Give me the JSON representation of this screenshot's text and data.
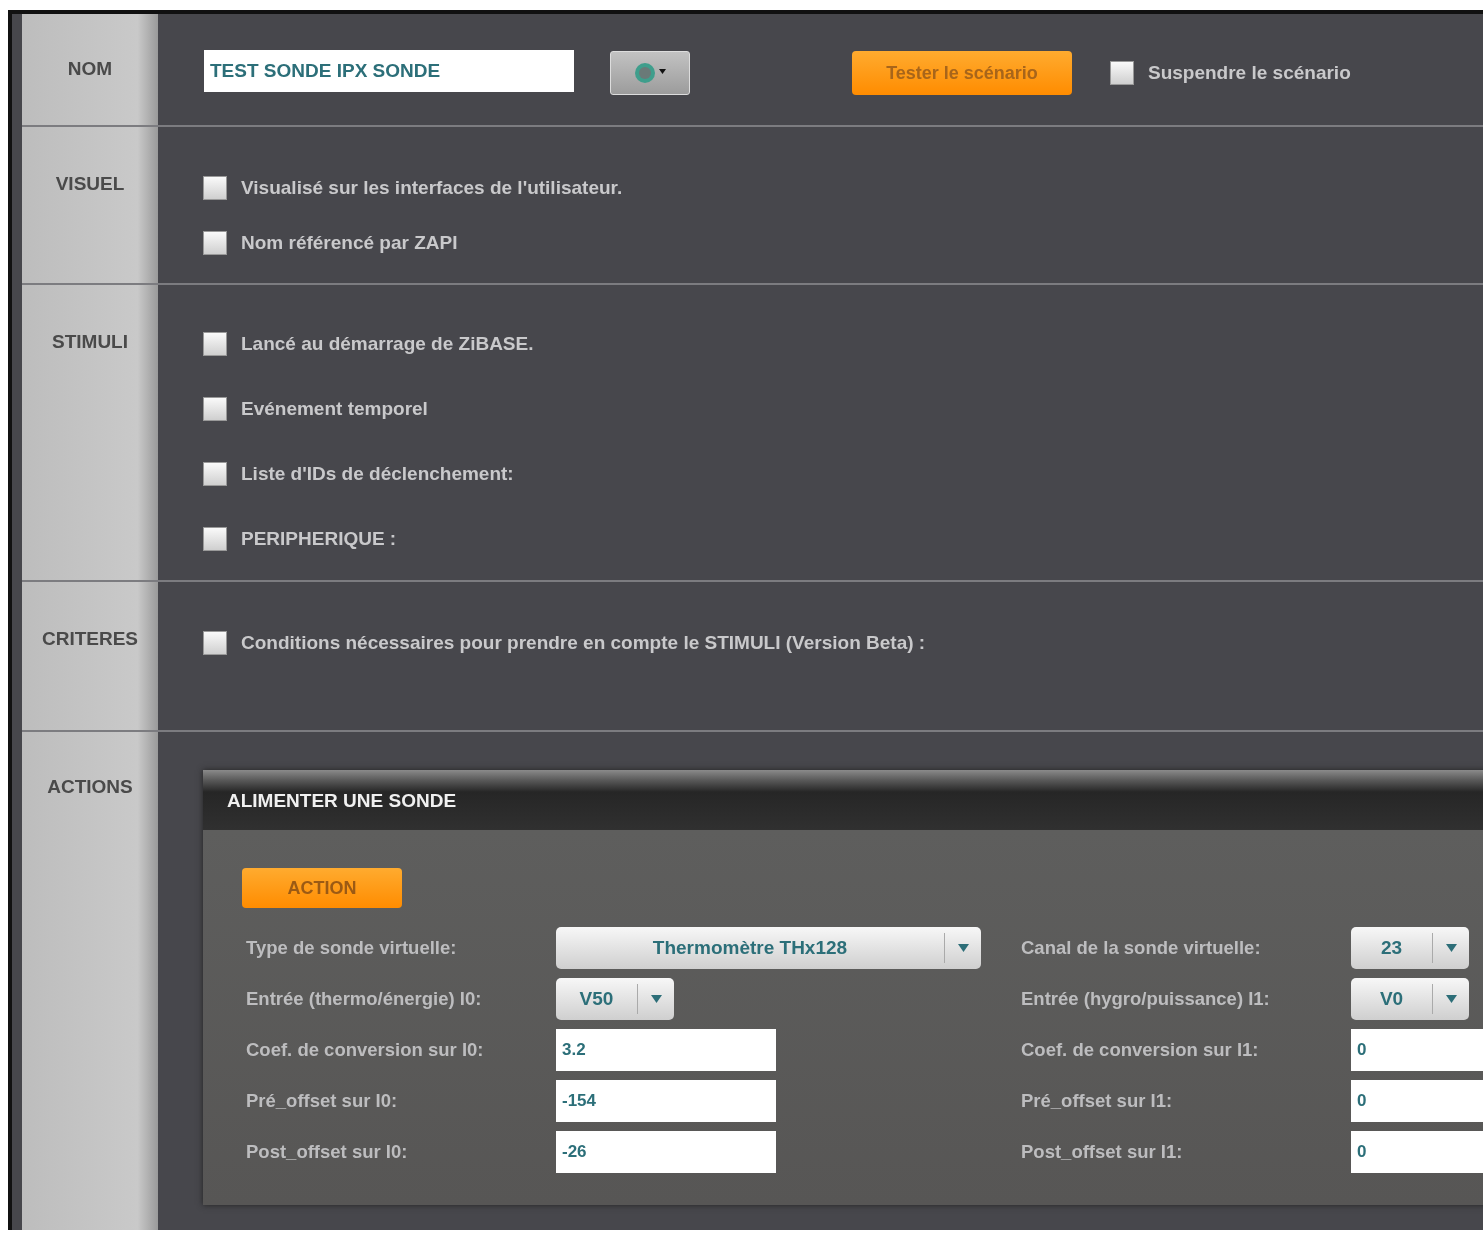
{
  "name_row": {
    "label": "NOM",
    "name_value": "TEST SONDE IPX SONDE",
    "test_button": "Tester le scénario",
    "suspend": {
      "label": "Suspendre le scénario",
      "checked": false
    }
  },
  "sections": [
    {
      "label": "VISUEL",
      "options": [
        {
          "label": "Visualisé sur les interfaces de l'utilisateur.",
          "checked": false
        },
        {
          "label": "Nom référencé par ZAPI",
          "checked": false
        }
      ]
    },
    {
      "label": "STIMULI",
      "options": [
        {
          "label": "Lancé au démarrage de ZiBASE.",
          "checked": false
        },
        {
          "label": "Evénement temporel",
          "checked": false
        },
        {
          "label": "Liste d'IDs de déclenchement:",
          "checked": false
        },
        {
          "label": "PERIPHERIQUE :",
          "checked": false
        }
      ]
    },
    {
      "label": "CRITERES",
      "options": [
        {
          "label": "Conditions nécessaires pour prendre en compte le STIMULI (Version Beta) :",
          "checked": false
        }
      ]
    }
  ],
  "actions": {
    "label": "ACTIONS",
    "panel": {
      "title": "ALIMENTER UNE SONDE",
      "action_button": "ACTION",
      "fields": [
        {
          "kind": "wide-select",
          "label": "Type de sonde virtuelle:",
          "value": "Thermomètre THx128"
        },
        {
          "kind": "select",
          "label": "Canal de la sonde virtuelle:",
          "value": "23"
        },
        {
          "kind": "select",
          "label": "Entrée (thermo/énergie) I0:",
          "value": "V50"
        },
        {
          "kind": "select",
          "label": "Entrée (hygro/puissance) I1:",
          "value": "V0"
        },
        {
          "kind": "input",
          "label": "Coef. de conversion sur I0:",
          "value": "3.2"
        },
        {
          "kind": "input",
          "label": "Coef. de conversion sur I1:",
          "value": "0"
        },
        {
          "kind": "input",
          "label": "Pré_offset sur I0:",
          "value": "-154"
        },
        {
          "kind": "input",
          "label": "Pré_offset sur I1:",
          "value": "0"
        },
        {
          "kind": "input",
          "label": "Post_offset sur I0:",
          "value": "-26"
        },
        {
          "kind": "input",
          "label": "Post_offset sur I1:",
          "value": "0"
        }
      ]
    }
  }
}
